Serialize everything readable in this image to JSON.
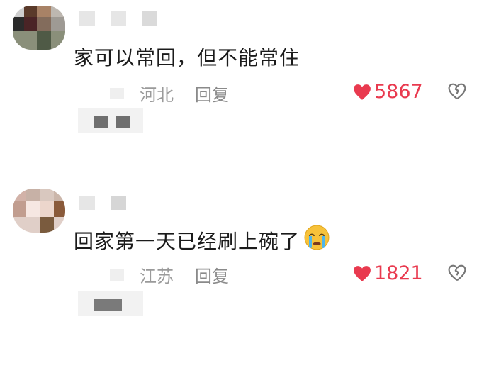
{
  "comments": [
    {
      "text": "家可以常回，但不能常住",
      "location": "河北",
      "reply_label": "回复",
      "likes": "5867",
      "emoji": ""
    },
    {
      "text": "回家第一天已经刷上碗了",
      "location": "江苏",
      "reply_label": "回复",
      "likes": "1821",
      "emoji": "crying-face-icon"
    }
  ],
  "colors": {
    "like": "#e93a4f",
    "meta": "#9a9a9a",
    "text": "#1b1b1b"
  }
}
